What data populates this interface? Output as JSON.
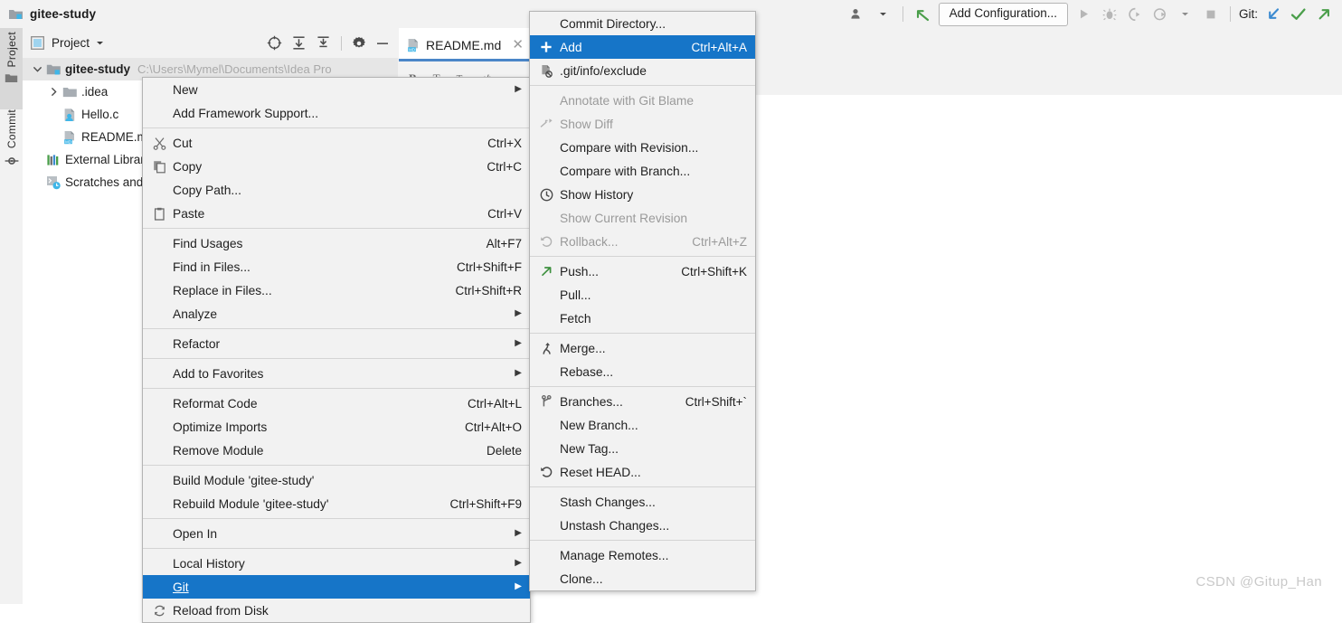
{
  "window": {
    "project_name": "gitee-study",
    "folder_icon": "project-folder-icon"
  },
  "toolbar": {
    "user_icon": "user-avatar-icon",
    "user_dropdown_icon": "chevron-down-icon",
    "back_icon": "back-arrow-icon",
    "add_configuration_label": "Add Configuration...",
    "run_icon": "run-icon",
    "debug_icon": "debug-icon",
    "run_with_coverage_icon": "run-with-coverage-icon",
    "profile_icon": "profile-icon",
    "profile_dropdown_icon": "chevron-down-icon",
    "stop_icon": "stop-icon",
    "git_label": "Git:",
    "update_project_icon": "update-project-icon",
    "commit_icon": "commit-checkmark-icon",
    "push_icon": "push-arrow-icon"
  },
  "toolstrip": {
    "items": [
      {
        "label": "Project",
        "icon": "project-folder-icon",
        "active": true
      },
      {
        "label": "Commit",
        "icon": "commit-node-icon",
        "active": false
      }
    ]
  },
  "project_panel": {
    "title": "Project",
    "dropdown_icon": "chevron-down-icon",
    "panel_icon": "project-view-icon",
    "actions": [
      {
        "name": "select-opened-file-icon",
        "label": "Select Opened File"
      },
      {
        "name": "expand-all-icon",
        "label": "Expand All"
      },
      {
        "name": "collapse-all-icon",
        "label": "Collapse All"
      },
      {
        "name": "gear-icon",
        "label": "Settings"
      },
      {
        "name": "hide-icon",
        "label": "Hide"
      }
    ],
    "tree": [
      {
        "label": "gitee-study",
        "path_hint": "C:\\Users\\Mymel\\Documents\\Idea Pro",
        "icon": "module-folder-icon",
        "twist": "expanded",
        "indent": 0,
        "bold": true,
        "selected": true
      },
      {
        "label": ".idea",
        "icon": "folder-icon",
        "twist": "collapsed",
        "indent": 1,
        "bold": false,
        "selected": false
      },
      {
        "label": "Hello.c",
        "icon": "c-file-icon",
        "twist": "none",
        "indent": 1,
        "bold": false,
        "selected": false
      },
      {
        "label": "README.md",
        "icon": "markdown-file-icon",
        "twist": "none",
        "indent": 1,
        "bold": false,
        "selected": false
      },
      {
        "label": "External Libraries",
        "icon": "external-libraries-icon",
        "twist": "none",
        "indent": 0,
        "bold": false,
        "selected": false
      },
      {
        "label": "Scratches and Consoles",
        "icon": "scratches-icon",
        "twist": "none",
        "indent": 0,
        "bold": false,
        "selected": false
      }
    ]
  },
  "editor": {
    "tabs": [
      {
        "label": "README.md",
        "icon": "markdown-file-icon",
        "close_icon": "close-icon",
        "active": true
      }
    ],
    "breadcrumb_icons": [
      "bold-icon",
      "header1-icon",
      "header2-icon",
      "code-icon",
      "list-icon"
    ]
  },
  "context_menu": {
    "items": [
      {
        "label": "New",
        "mnemonic": "",
        "accel": "",
        "submenu": true,
        "icon": "",
        "disabled": false,
        "selected": false
      },
      {
        "label": "Add Framework Support...",
        "accel": "",
        "submenu": false,
        "icon": "",
        "disabled": false,
        "selected": false
      },
      {
        "separator": true
      },
      {
        "label": "Cut",
        "mnemonic": "t",
        "accel": "Ctrl+X",
        "submenu": false,
        "icon": "cut-scissors-icon",
        "disabled": false,
        "selected": false
      },
      {
        "label": "Copy",
        "mnemonic": "C",
        "accel": "Ctrl+C",
        "submenu": false,
        "icon": "copy-icon",
        "disabled": false,
        "selected": false
      },
      {
        "label": "Copy Path...",
        "accel": "",
        "submenu": false,
        "icon": "",
        "disabled": false,
        "selected": false
      },
      {
        "label": "Paste",
        "mnemonic": "P",
        "accel": "Ctrl+V",
        "submenu": false,
        "icon": "paste-clipboard-icon",
        "disabled": false,
        "selected": false
      },
      {
        "separator": true
      },
      {
        "label": "Find Usages",
        "mnemonic": "U",
        "accel": "Alt+F7",
        "submenu": false,
        "icon": "",
        "disabled": false,
        "selected": false
      },
      {
        "label": "Find in Files...",
        "accel": "Ctrl+Shift+F",
        "submenu": false,
        "icon": "",
        "disabled": false,
        "selected": false
      },
      {
        "label": "Replace in Files...",
        "mnemonic": "a",
        "accel": "Ctrl+Shift+R",
        "submenu": false,
        "icon": "",
        "disabled": false,
        "selected": false
      },
      {
        "label": "Analyze",
        "mnemonic": "z",
        "accel": "",
        "submenu": true,
        "icon": "",
        "disabled": false,
        "selected": false
      },
      {
        "separator": true
      },
      {
        "label": "Refactor",
        "mnemonic": "R",
        "accel": "",
        "submenu": true,
        "icon": "",
        "disabled": false,
        "selected": false
      },
      {
        "separator": true
      },
      {
        "label": "Add to Favorites",
        "mnemonic": "a",
        "accel": "",
        "submenu": true,
        "icon": "",
        "disabled": false,
        "selected": false
      },
      {
        "separator": true
      },
      {
        "label": "Reformat Code",
        "mnemonic": "R",
        "accel": "Ctrl+Alt+L",
        "submenu": false,
        "icon": "",
        "disabled": false,
        "selected": false
      },
      {
        "label": "Optimize Imports",
        "mnemonic": "z",
        "accel": "Ctrl+Alt+O",
        "submenu": false,
        "icon": "",
        "disabled": false,
        "selected": false
      },
      {
        "label": "Remove Module",
        "accel": "Delete",
        "submenu": false,
        "icon": "",
        "disabled": false,
        "selected": false
      },
      {
        "separator": true
      },
      {
        "label": "Build Module 'gitee-study'",
        "mnemonic": "M",
        "accel": "",
        "submenu": false,
        "icon": "",
        "disabled": false,
        "selected": false
      },
      {
        "label": "Rebuild Module 'gitee-study'",
        "mnemonic": "e",
        "accel": "Ctrl+Shift+F9",
        "submenu": false,
        "icon": "",
        "disabled": false,
        "selected": false
      },
      {
        "separator": true
      },
      {
        "label": "Open In",
        "accel": "",
        "submenu": true,
        "icon": "",
        "disabled": false,
        "selected": false
      },
      {
        "separator": true
      },
      {
        "label": "Local History",
        "mnemonic": "H",
        "accel": "",
        "submenu": true,
        "icon": "",
        "disabled": false,
        "selected": false
      },
      {
        "label": "Git",
        "mnemonic": "G",
        "accel": "",
        "submenu": true,
        "icon": "",
        "disabled": false,
        "selected": true
      },
      {
        "label": "Reload from Disk",
        "accel": "",
        "submenu": false,
        "icon": "reload-icon",
        "disabled": false,
        "selected": false
      }
    ]
  },
  "git_submenu": {
    "items": [
      {
        "label": "Commit Directory...",
        "mnemonic": "i",
        "accel": "",
        "icon": "",
        "disabled": false,
        "selected": false
      },
      {
        "label": "Add",
        "accel": "Ctrl+Alt+A",
        "icon": "add-plus-icon",
        "disabled": false,
        "selected": true
      },
      {
        "label": ".git/info/exclude",
        "accel": "",
        "icon": "git-exclude-icon",
        "disabled": false,
        "selected": false
      },
      {
        "separator": true
      },
      {
        "label": "Annotate with Git Blame",
        "mnemonic": "n",
        "accel": "",
        "icon": "",
        "disabled": true,
        "selected": false
      },
      {
        "label": "Show Diff",
        "accel": "",
        "icon": "show-diff-icon",
        "disabled": true,
        "selected": false
      },
      {
        "label": "Compare with Revision...",
        "mnemonic": "C",
        "accel": "",
        "icon": "",
        "disabled": false,
        "selected": false
      },
      {
        "label": "Compare with Branch...",
        "accel": "",
        "icon": "",
        "disabled": false,
        "selected": false
      },
      {
        "label": "Show History",
        "mnemonic": "H",
        "accel": "",
        "icon": "history-clock-icon",
        "disabled": false,
        "selected": false
      },
      {
        "label": "Show Current Revision",
        "accel": "",
        "icon": "",
        "disabled": true,
        "selected": false
      },
      {
        "label": "Rollback...",
        "mnemonic": "R",
        "accel": "Ctrl+Alt+Z",
        "icon": "rollback-icon",
        "disabled": true,
        "selected": false
      },
      {
        "separator": true
      },
      {
        "label": "Push...",
        "accel": "Ctrl+Shift+K",
        "icon": "push-arrow-icon",
        "disabled": false,
        "selected": false
      },
      {
        "label": "Pull...",
        "accel": "",
        "icon": "",
        "disabled": false,
        "selected": false
      },
      {
        "label": "Fetch",
        "accel": "",
        "icon": "",
        "disabled": false,
        "selected": false
      },
      {
        "separator": true
      },
      {
        "label": "Merge...",
        "accel": "",
        "icon": "merge-icon",
        "disabled": false,
        "selected": false
      },
      {
        "label": "Rebase...",
        "accel": "",
        "icon": "",
        "disabled": false,
        "selected": false
      },
      {
        "separator": true
      },
      {
        "label": "Branches...",
        "mnemonic": "B",
        "accel": "Ctrl+Shift+`",
        "icon": "branch-icon",
        "disabled": false,
        "selected": false
      },
      {
        "label": "New Branch...",
        "accel": "",
        "icon": "",
        "disabled": false,
        "selected": false
      },
      {
        "label": "New Tag...",
        "accel": "",
        "icon": "",
        "disabled": false,
        "selected": false
      },
      {
        "label": "Reset HEAD...",
        "accel": "",
        "icon": "reset-head-icon",
        "disabled": false,
        "selected": false
      },
      {
        "separator": true
      },
      {
        "label": "Stash Changes...",
        "accel": "",
        "icon": "",
        "disabled": false,
        "selected": false
      },
      {
        "label": "Unstash Changes...",
        "accel": "",
        "icon": "",
        "disabled": false,
        "selected": false
      },
      {
        "separator": true
      },
      {
        "label": "Manage Remotes...",
        "accel": "",
        "icon": "",
        "disabled": false,
        "selected": false
      },
      {
        "label": "Clone...",
        "accel": "",
        "icon": "",
        "disabled": false,
        "selected": false
      }
    ]
  },
  "watermark": {
    "text": "CSDN @Gitup_Han"
  },
  "colors": {
    "selection_blue": "#1675c8",
    "tab_underline": "#4a86c8",
    "panel_bg": "#f2f2f2",
    "menu_bg": "#f2f2f2",
    "green_accent": "#4a9e4a",
    "blue_accent": "#3b8ad0"
  }
}
